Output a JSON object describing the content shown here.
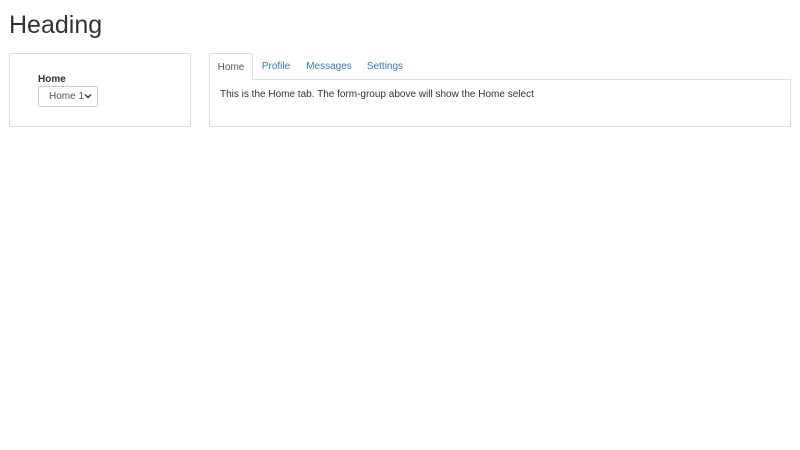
{
  "page": {
    "heading": "Heading"
  },
  "form": {
    "label": "Home",
    "select": {
      "selected": "Home 1"
    }
  },
  "tabs": [
    {
      "label": "Home",
      "active": true
    },
    {
      "label": "Profile",
      "active": false
    },
    {
      "label": "Messages",
      "active": false
    },
    {
      "label": "Settings",
      "active": false
    }
  ],
  "tab_content": {
    "text": "This is the Home tab. The form-group above will show the Home select"
  },
  "colors": {
    "link": "#337ab7",
    "border": "#dddddd",
    "text": "#333333"
  }
}
